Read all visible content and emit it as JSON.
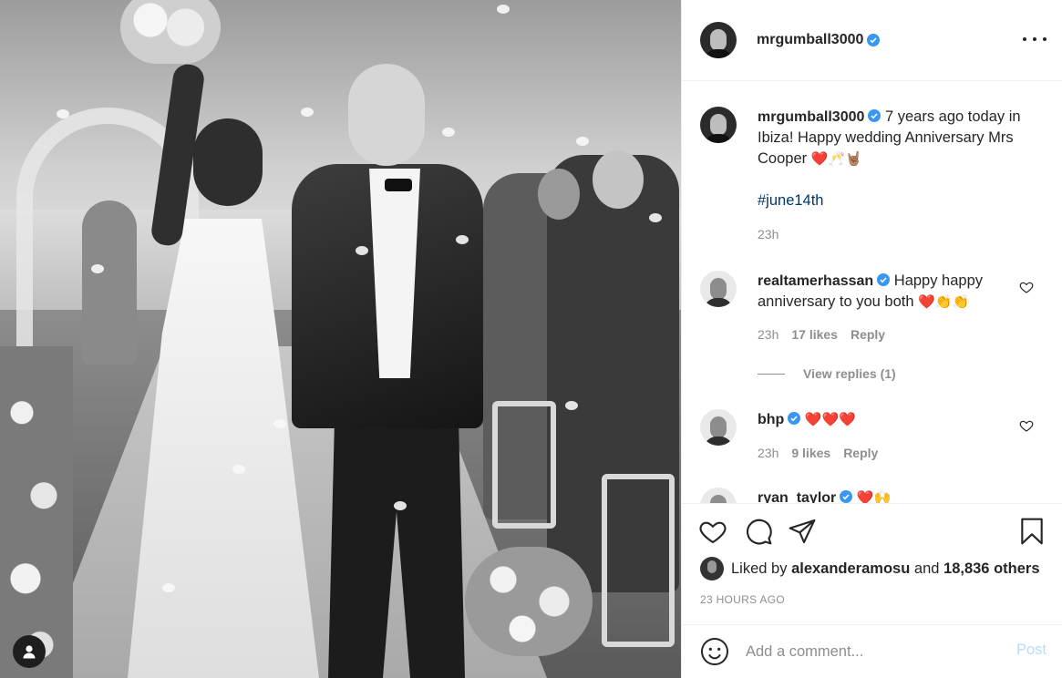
{
  "post": {
    "author": "mrgumball3000",
    "more_icon": "more-horizontal-icon"
  },
  "caption": {
    "author": "mrgumball3000",
    "text": "7 years ago today in Ibiza! Happy wedding Anniversary Mrs Cooper",
    "emojis": "❤️🥂🤘🏽",
    "hashtag": "#june14th",
    "time": "23h"
  },
  "comments": [
    {
      "author": "realtamerhassan",
      "text": "Happy happy anniversary to you both",
      "emojis": "❤️👏👏",
      "time": "23h",
      "likes": "17 likes",
      "reply": "Reply"
    },
    {
      "author": "bhp",
      "text": "",
      "emojis": "❤️❤️❤️",
      "time": "23h",
      "likes": "9 likes",
      "reply": "Reply"
    },
    {
      "author": "ryan_taylor",
      "emojis": "❤️🙌"
    }
  ],
  "view_replies": "View replies (1)",
  "likes": {
    "prefix": "Liked by",
    "user": "alexanderamosu",
    "and": "and",
    "others": "18,836 others"
  },
  "timestamp": "23 HOURS AGO",
  "add_comment": {
    "placeholder": "Add a comment...",
    "post_label": "Post"
  },
  "colors": {
    "verified": "#3897f0",
    "post_button_disabled": "#b2dffc",
    "hashtag": "#00376b",
    "secondary_text": "#8e8e8e"
  }
}
